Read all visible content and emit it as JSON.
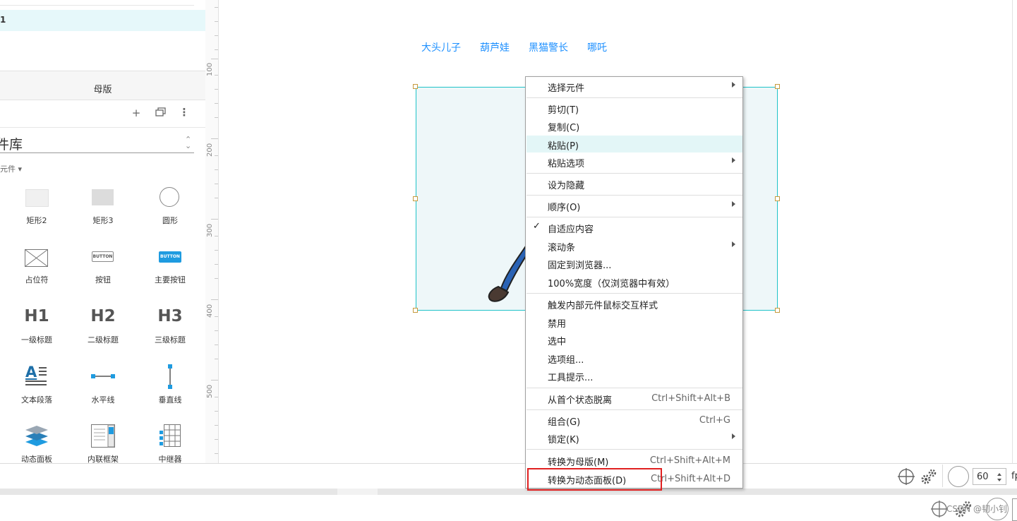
{
  "left_panel": {
    "selected_page_label": "1",
    "tab_label": "母版",
    "library_title": "件库",
    "library_filter": "元件 ▾",
    "widgets": [
      {
        "label": "矩形2",
        "icon": "rect2-icon"
      },
      {
        "label": "矩形3",
        "icon": "rect3-icon"
      },
      {
        "label": "圆形",
        "icon": "circle-icon"
      },
      {
        "label": "占位符",
        "icon": "placeholder-icon"
      },
      {
        "label": "按钮",
        "icon": "button-icon",
        "icon_text": "BUTTON"
      },
      {
        "label": "主要按钮",
        "icon": "primary-button-icon",
        "icon_text": "BUTTON"
      },
      {
        "label": "一级标题",
        "icon": "h1-icon",
        "icon_text": "H1"
      },
      {
        "label": "二级标题",
        "icon": "h2-icon",
        "icon_text": "H2"
      },
      {
        "label": "三级标题",
        "icon": "h3-icon",
        "icon_text": "H3"
      },
      {
        "label": "文本段落",
        "icon": "paragraph-icon",
        "icon_text": "A"
      },
      {
        "label": "水平线",
        "icon": "horizontal-line-icon"
      },
      {
        "label": "垂直线",
        "icon": "vertical-line-icon"
      },
      {
        "label": "动态面板",
        "icon": "dynamic-panel-icon"
      },
      {
        "label": "内联框架",
        "icon": "inline-frame-icon"
      },
      {
        "label": "中继器",
        "icon": "repeater-icon"
      }
    ]
  },
  "ruler": {
    "labels": [
      "100",
      "200",
      "300",
      "400",
      "500"
    ]
  },
  "canvas": {
    "nav_links": [
      "大头儿子",
      "葫芦娃",
      "黑猫警长",
      "哪吒"
    ]
  },
  "context_menu": {
    "items": [
      {
        "label": "选择元件",
        "shortcut": "",
        "submenu": true
      },
      {
        "label": "剪切(T)",
        "shortcut": ""
      },
      {
        "label": "复制(C)",
        "shortcut": ""
      },
      {
        "label": "粘贴(P)",
        "shortcut": "",
        "highlighted": true
      },
      {
        "label": "粘贴选项",
        "shortcut": "",
        "submenu": true
      },
      {
        "label": "设为隐藏",
        "shortcut": ""
      },
      {
        "label": "顺序(O)",
        "shortcut": "",
        "submenu": true
      },
      {
        "label": "自适应内容",
        "shortcut": "",
        "checked": true
      },
      {
        "label": "滚动条",
        "shortcut": "",
        "submenu": true
      },
      {
        "label": "固定到浏览器...",
        "shortcut": ""
      },
      {
        "label": "100%宽度（仅浏览器中有效）",
        "shortcut": ""
      },
      {
        "label": "触发内部元件鼠标交互样式",
        "shortcut": ""
      },
      {
        "label": "禁用",
        "shortcut": ""
      },
      {
        "label": "选中",
        "shortcut": ""
      },
      {
        "label": "选项组...",
        "shortcut": ""
      },
      {
        "label": "工具提示...",
        "shortcut": ""
      },
      {
        "label": "从首个状态脱离",
        "shortcut": "Ctrl+Shift+Alt+B"
      },
      {
        "label": "组合(G)",
        "shortcut": "Ctrl+G"
      },
      {
        "label": "锁定(K)",
        "shortcut": "",
        "submenu": true
      },
      {
        "label": "转换为母版(M)",
        "shortcut": "Ctrl+Shift+Alt+M"
      },
      {
        "label": "转换为动态面板(D)",
        "shortcut": "Ctrl+Shift+Alt+D"
      }
    ],
    "check_mark": "✓"
  },
  "bottom_bar": {
    "fps_value": "60",
    "fps_unit": "fp"
  },
  "footer": {
    "watermark": "CSDN @韧小钊"
  },
  "colors": {
    "accent": "#1fc3c8",
    "link": "#1e90ff",
    "highlight_box": "#e02020"
  }
}
